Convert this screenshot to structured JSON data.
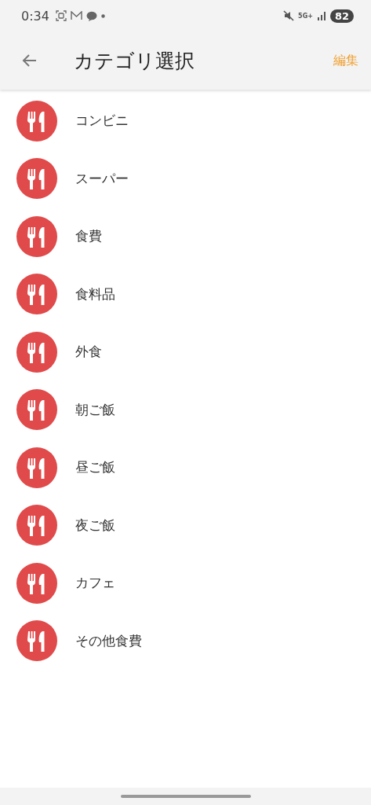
{
  "status_bar": {
    "time": "0:34",
    "network": "5G+",
    "battery": "82"
  },
  "header": {
    "title": "カテゴリ選択",
    "action": "編集"
  },
  "categories": [
    {
      "name": "コンビニ"
    },
    {
      "name": "スーパー"
    },
    {
      "name": "食費"
    },
    {
      "name": "食料品"
    },
    {
      "name": "外食"
    },
    {
      "name": "朝ご飯"
    },
    {
      "name": "昼ご飯"
    },
    {
      "name": "夜ご飯"
    },
    {
      "name": "カフェ"
    },
    {
      "name": "その他食費"
    }
  ]
}
